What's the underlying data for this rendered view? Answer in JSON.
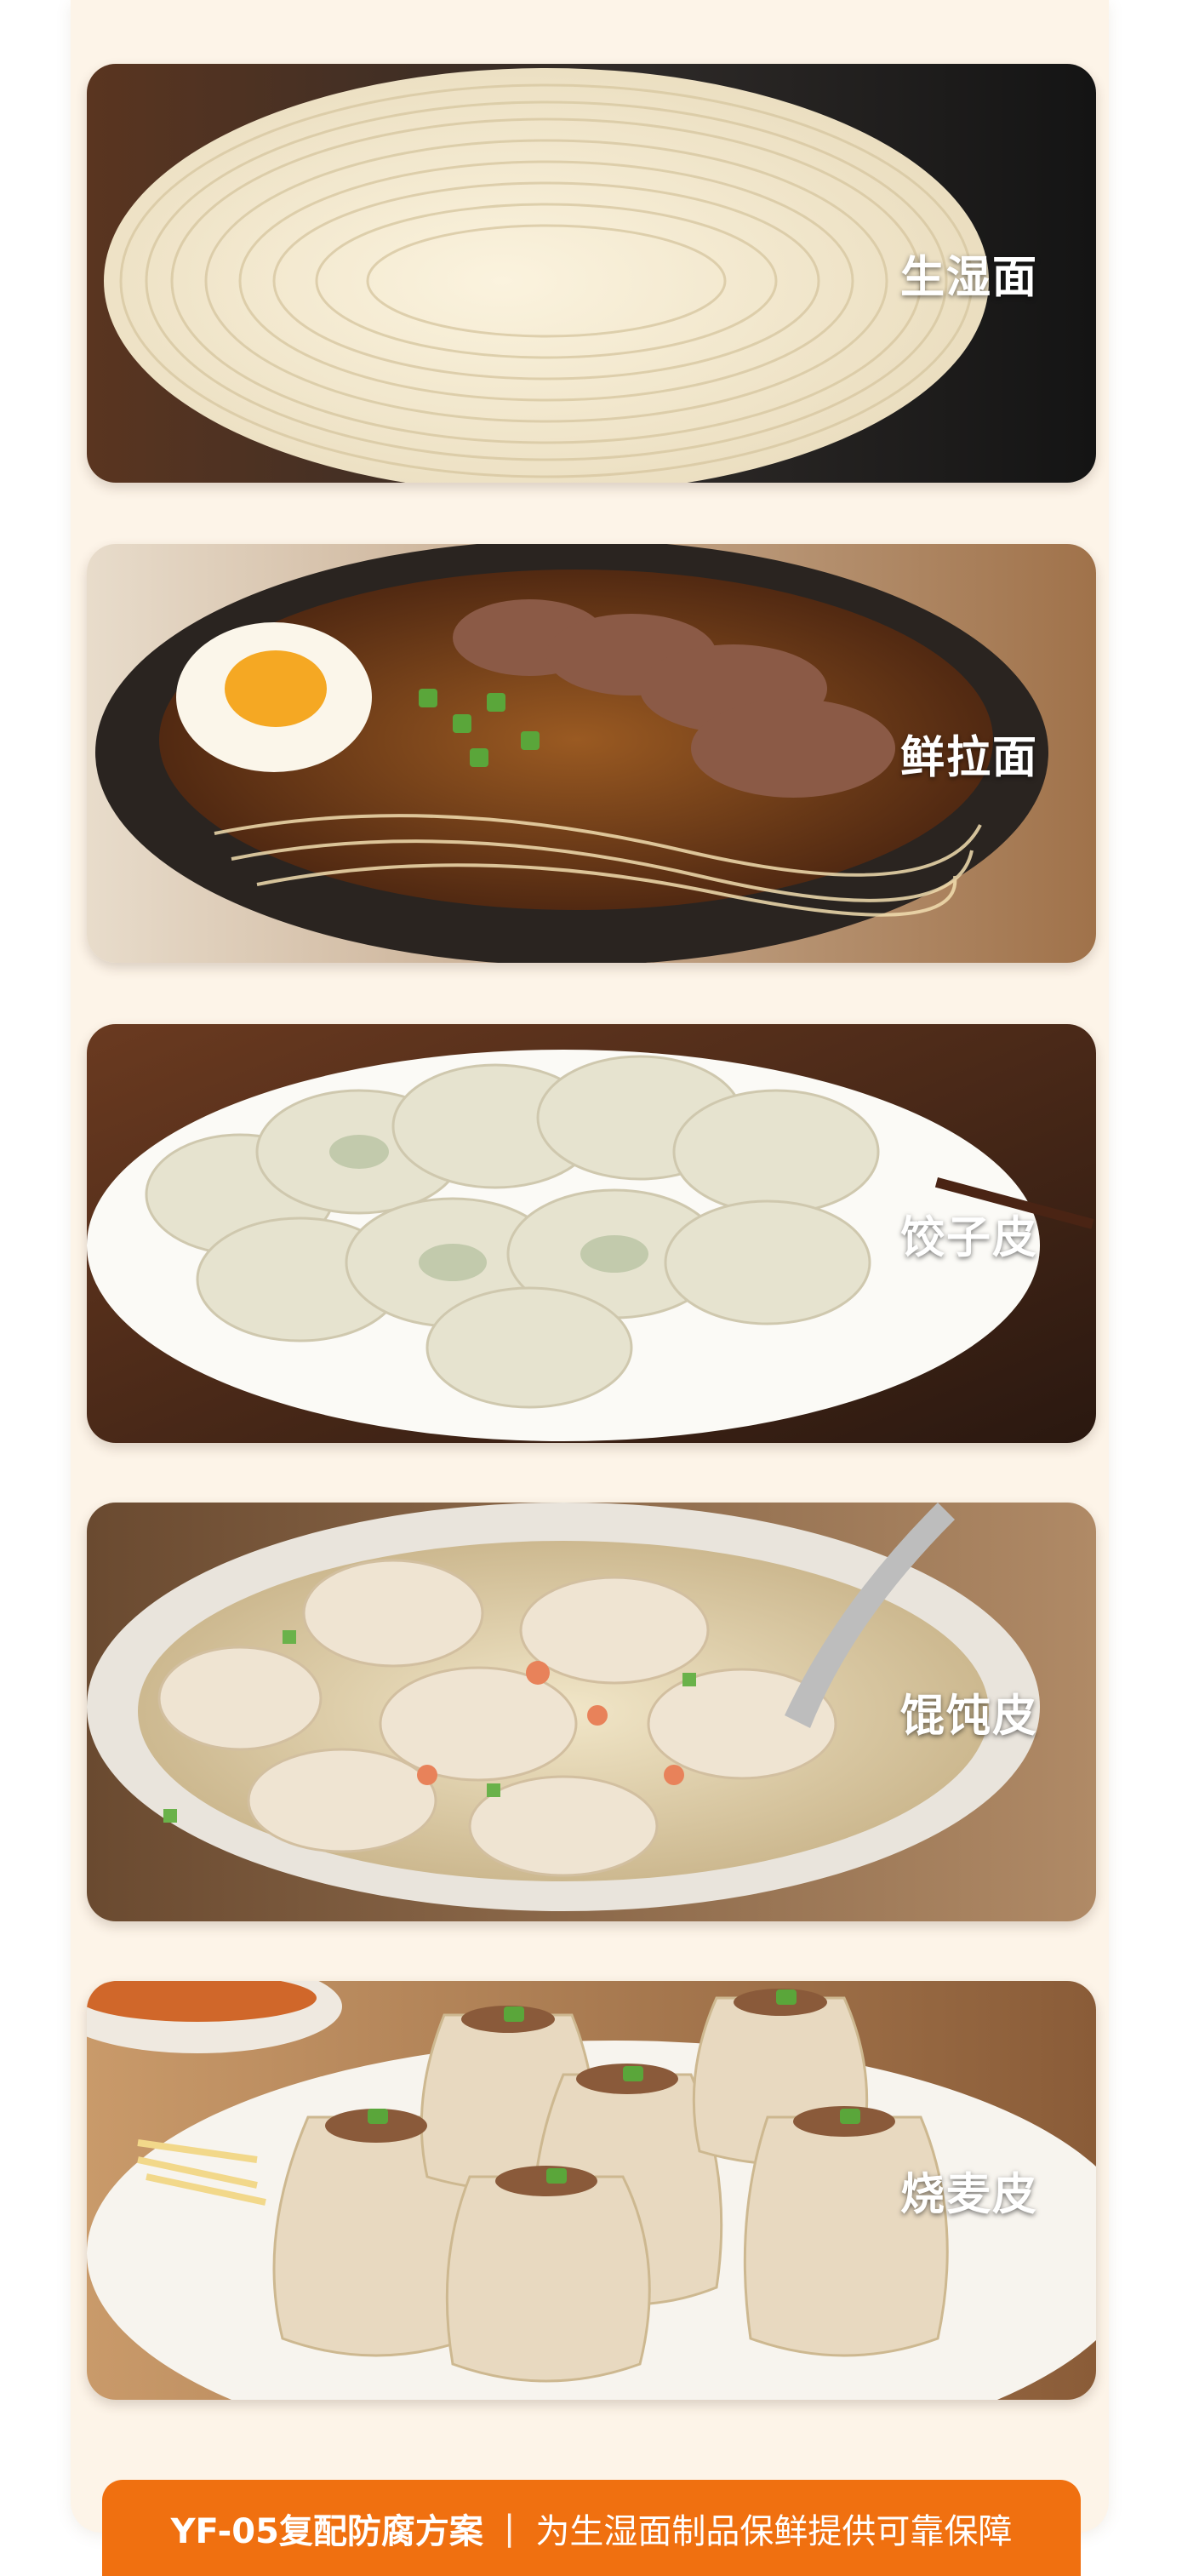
{
  "products": [
    {
      "label": "生湿面",
      "image": "fresh-wet-noodles-photo"
    },
    {
      "label": "鲜拉面",
      "image": "ramen-bowl-photo"
    },
    {
      "label": "饺子皮",
      "image": "dumplings-plate-photo"
    },
    {
      "label": "馄饨皮",
      "image": "wonton-soup-photo"
    },
    {
      "label": "烧麦皮",
      "image": "shumai-plate-photo"
    }
  ],
  "banner": {
    "title": "YF-05复配防腐方案",
    "divider": "|",
    "subtitle": "为生湿面制品保鲜提供可靠保障"
  },
  "colors": {
    "panel_background": "#fdf4e8",
    "banner_orange": "#f07010",
    "label_text": "#ffffff"
  }
}
